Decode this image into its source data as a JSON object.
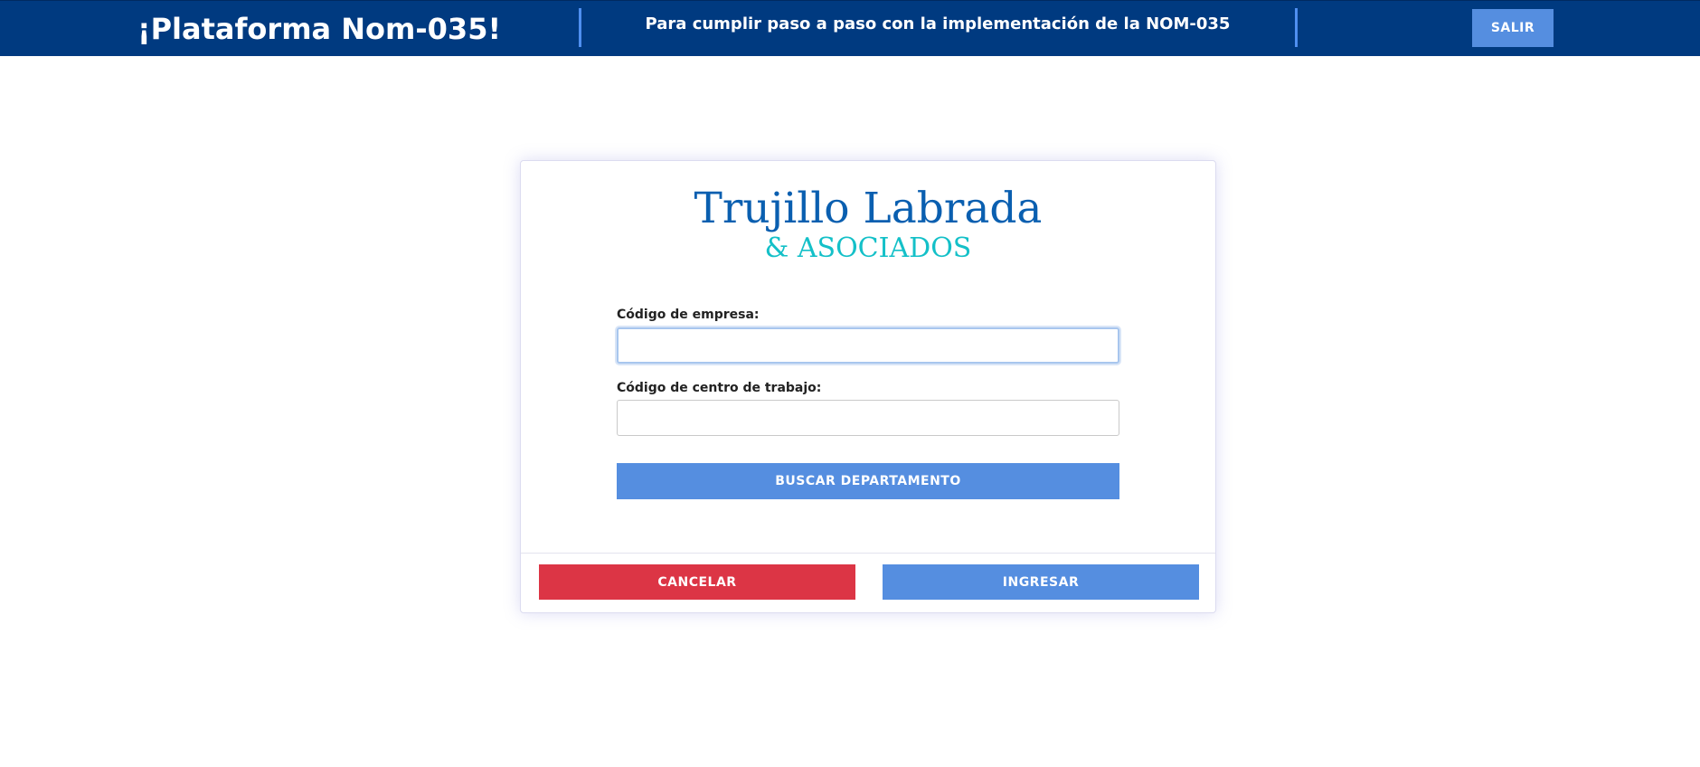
{
  "header": {
    "brand": "¡Plataforma Nom-035!",
    "tagline": "Para cumplir paso a paso con la implementación de la NOM-035",
    "logout_label": "SALIR"
  },
  "card": {
    "logo": {
      "line1": "Trujillo Labrada",
      "line2": "& ASOCIADOS"
    },
    "fields": {
      "empresa": {
        "label": "Código de empresa:",
        "value": "",
        "placeholder": ""
      },
      "centro": {
        "label": "Código de centro de trabajo:",
        "value": "",
        "placeholder": ""
      }
    },
    "search_button_label": "BUSCAR DEPARTAMENTO",
    "cancel_button_label": "CANCELAR",
    "submit_button_label": "INGRESAR"
  },
  "colors": {
    "header_bg": "#003a80",
    "accent_blue": "#558ee0",
    "danger_red": "#dc3545",
    "logo_blue": "#0a5fb0",
    "logo_teal": "#14c0c8"
  }
}
